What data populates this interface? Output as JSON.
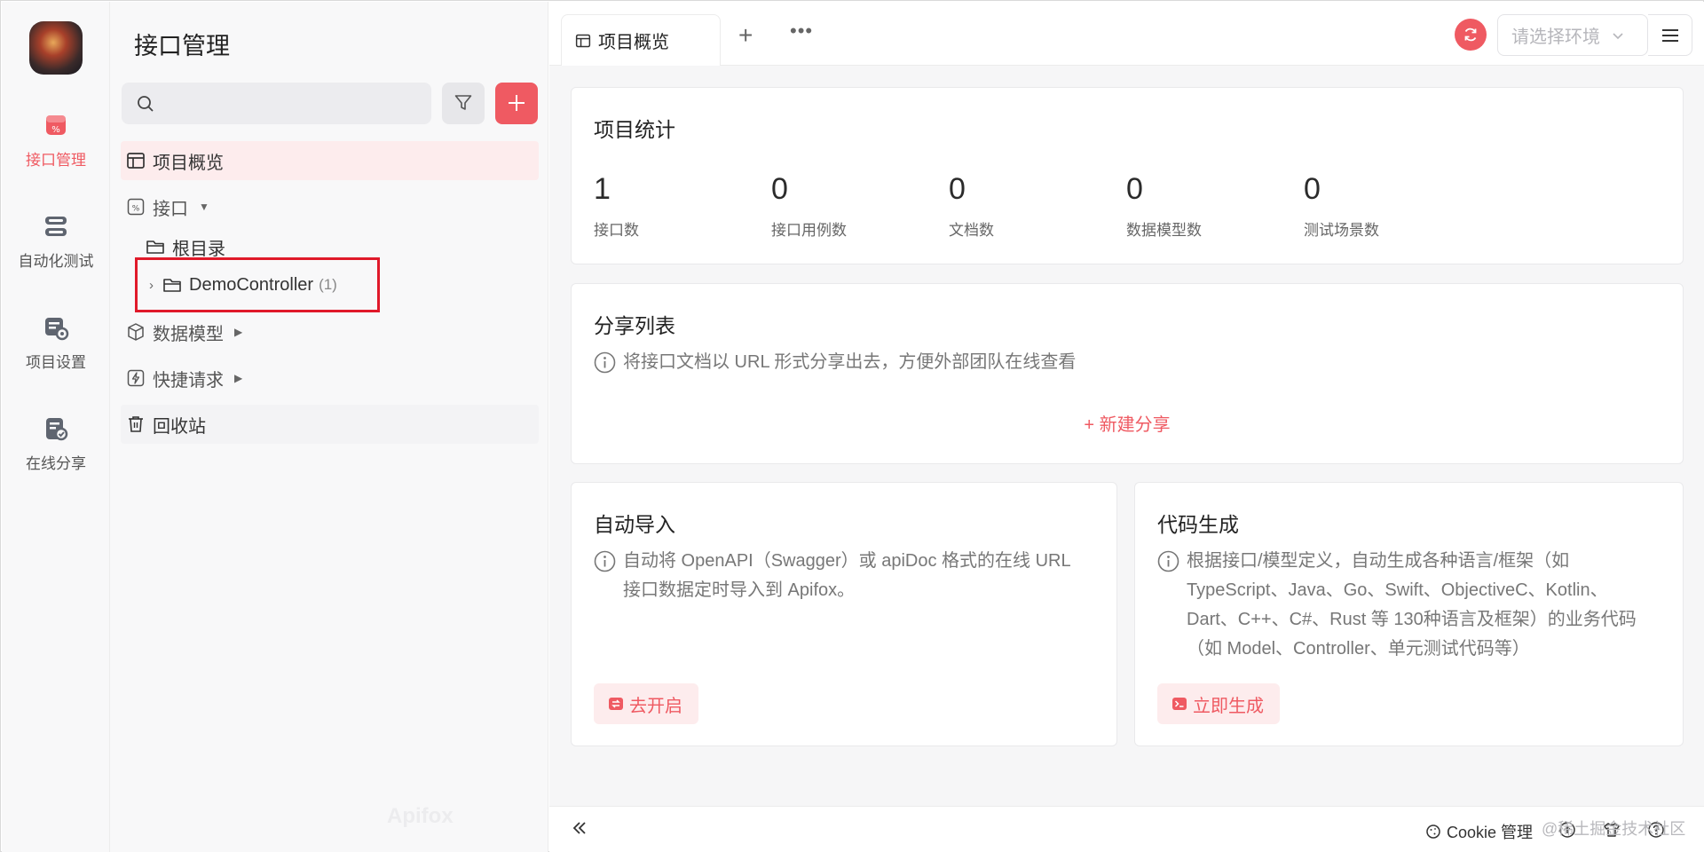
{
  "rail": {
    "items": [
      {
        "label": "接口管理",
        "icon": "api-icon",
        "active": true
      },
      {
        "label": "自动化测试",
        "icon": "automation-icon",
        "active": false
      },
      {
        "label": "项目设置",
        "icon": "project-settings-icon",
        "active": false
      },
      {
        "label": "在线分享",
        "icon": "online-share-icon",
        "active": false
      }
    ]
  },
  "tree": {
    "title": "接口管理",
    "search_placeholder": "",
    "items": [
      {
        "label": "项目概览",
        "icon": "overview-icon"
      },
      {
        "label": "接口",
        "icon": "api-icon"
      },
      {
        "label": "根目录",
        "icon": "folder-icon"
      },
      {
        "label": "DemoController",
        "count": "(1)",
        "icon": "folder-icon"
      },
      {
        "label": "数据模型",
        "icon": "cube-icon"
      },
      {
        "label": "快捷请求",
        "icon": "lightning-icon"
      },
      {
        "label": "回收站",
        "icon": "trash-icon"
      }
    ],
    "watermark": "Apifox"
  },
  "tabs": [
    {
      "label": "项目概览",
      "active": true
    }
  ],
  "header": {
    "env_placeholder": "请选择环境"
  },
  "stats": {
    "title": "项目统计",
    "items": [
      {
        "value": "1",
        "label": "接口数"
      },
      {
        "value": "0",
        "label": "接口用例数"
      },
      {
        "value": "0",
        "label": "文档数"
      },
      {
        "value": "0",
        "label": "数据模型数"
      },
      {
        "value": "0",
        "label": "测试场景数"
      }
    ]
  },
  "share": {
    "title": "分享列表",
    "info": "将接口文档以 URL 形式分享出去，方便外部团队在线查看",
    "new_label": "+ 新建分享"
  },
  "auto_import": {
    "title": "自动导入",
    "info_lines": [
      "自动将 OpenAPI（Swagger）或 apiDoc 格式的在线 URL",
      "接口数据定时导入到 Apifox。"
    ],
    "button": "去开启"
  },
  "codegen": {
    "title": "代码生成",
    "info_lines": [
      "根据接口/模型定义，自动生成各种语言/框架（如",
      "TypeScript、Java、Go、Swift、ObjectiveC、Kotlin、",
      "Dart、C++、C#、Rust 等 130种语言及框架）的业务代码",
      "（如 Model、Controller、单元测试代码等）"
    ],
    "button": "立即生成"
  },
  "footer": {
    "cookie_label": "Cookie 管理",
    "watermark": "@稀土掘金技术社区"
  },
  "colors": {
    "accent": "#ef5a62",
    "highlight_box": "#e0192a"
  }
}
